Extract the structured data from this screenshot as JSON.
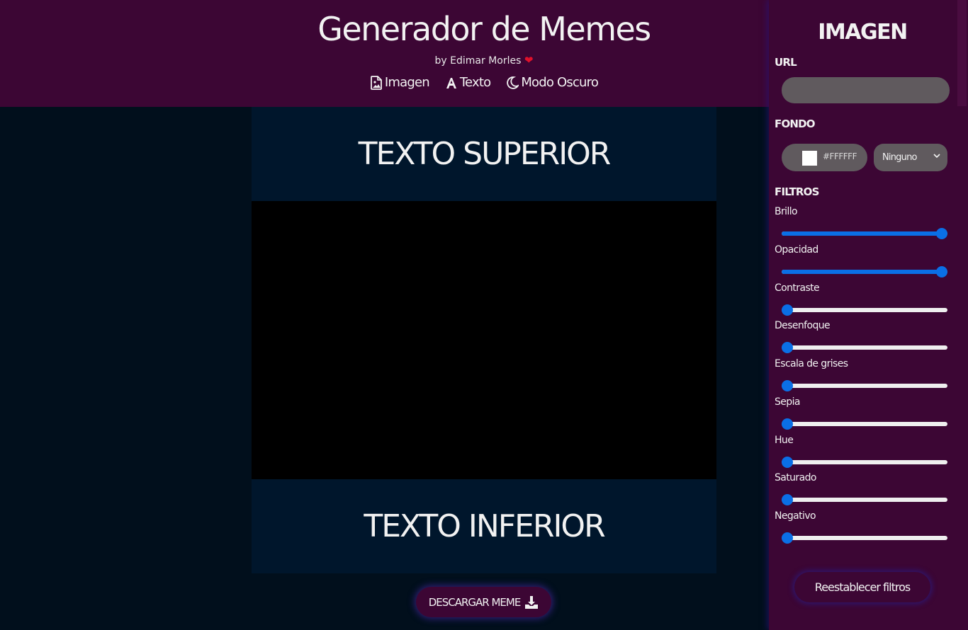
{
  "header": {
    "title": "Generador de Memes",
    "byline": "by Edimar Morles",
    "heart": "❤",
    "nav": [
      {
        "label": "Imagen",
        "icon": "image-file-icon"
      },
      {
        "label": "Texto",
        "icon": "text-a-icon"
      },
      {
        "label": "Modo Oscuro",
        "icon": "moon-icon"
      }
    ]
  },
  "meme": {
    "top_text": "TEXTO SUPERIOR",
    "bottom_text": "TEXTO INFERIOR"
  },
  "download_button": {
    "label": "DESCARGAR MEME",
    "icon": "download-icon"
  },
  "panel": {
    "title": "IMAGEN",
    "url_label": "URL",
    "url_value": "",
    "background_label": "FONDO",
    "background_color": "#FFFFFF",
    "blend_mode": "Ninguno",
    "filters_label": "FILTROS",
    "filters": [
      {
        "label": "Brillo",
        "value": 1.0
      },
      {
        "label": "Opacidad",
        "value": 1.0
      },
      {
        "label": "Contraste",
        "value": 0.0
      },
      {
        "label": "Desenfoque",
        "value": 0.0
      },
      {
        "label": "Escala de grises",
        "value": 0.0
      },
      {
        "label": "Sepia",
        "value": 0.0
      },
      {
        "label": "Hue",
        "value": 0.0
      },
      {
        "label": "Saturado",
        "value": 0.0
      },
      {
        "label": "Negativo",
        "value": 0.0
      }
    ],
    "reset_label": "Reestablecer filtros"
  },
  "colors": {
    "header_bg": "#3c0634",
    "page_bg": "#010f1c",
    "meme_text_bg": "#00162c",
    "slider_accent": "#0a6fe6"
  }
}
